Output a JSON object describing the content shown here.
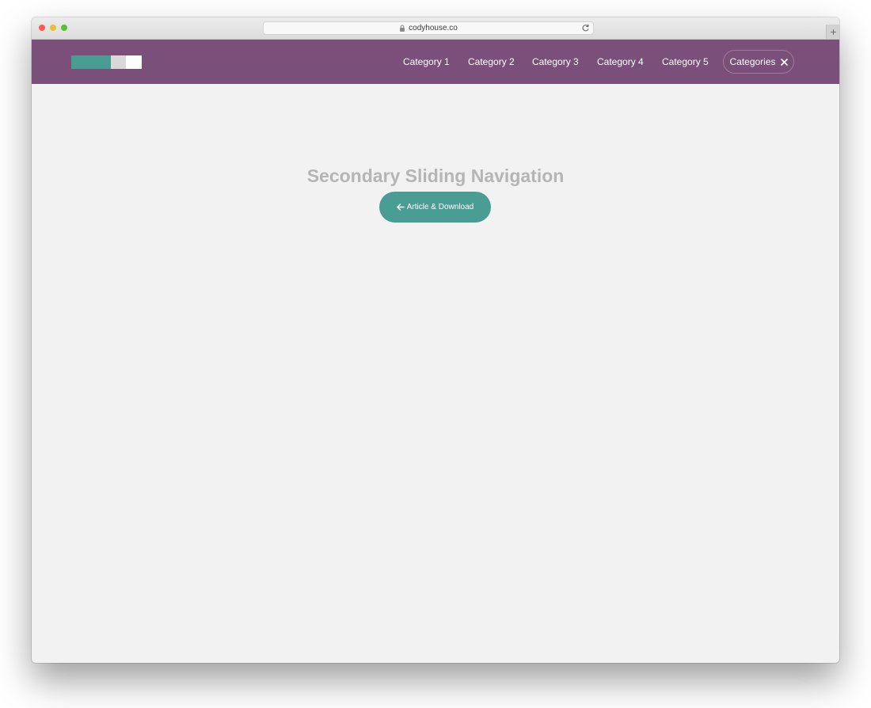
{
  "browser": {
    "url": "codyhouse.co",
    "newtab_label": "+"
  },
  "header": {
    "nav_items": [
      "Category 1",
      "Category 2",
      "Category 3",
      "Category 4",
      "Category 5"
    ],
    "categories_button_label": "Categories",
    "background_color": "#7a4f79",
    "logo_colors": [
      "#4a9d93",
      "#d9d9d9",
      "#ffffff"
    ]
  },
  "main": {
    "title": "Secondary Sliding Navigation",
    "cta_label": "Article & Download",
    "cta_color": "#4a9d93",
    "background_color": "#f2f2f2"
  },
  "icons": {
    "lock": "lock-icon",
    "reload": "reload-icon",
    "close": "close-icon",
    "arrow_left": "arrow-left-icon"
  }
}
